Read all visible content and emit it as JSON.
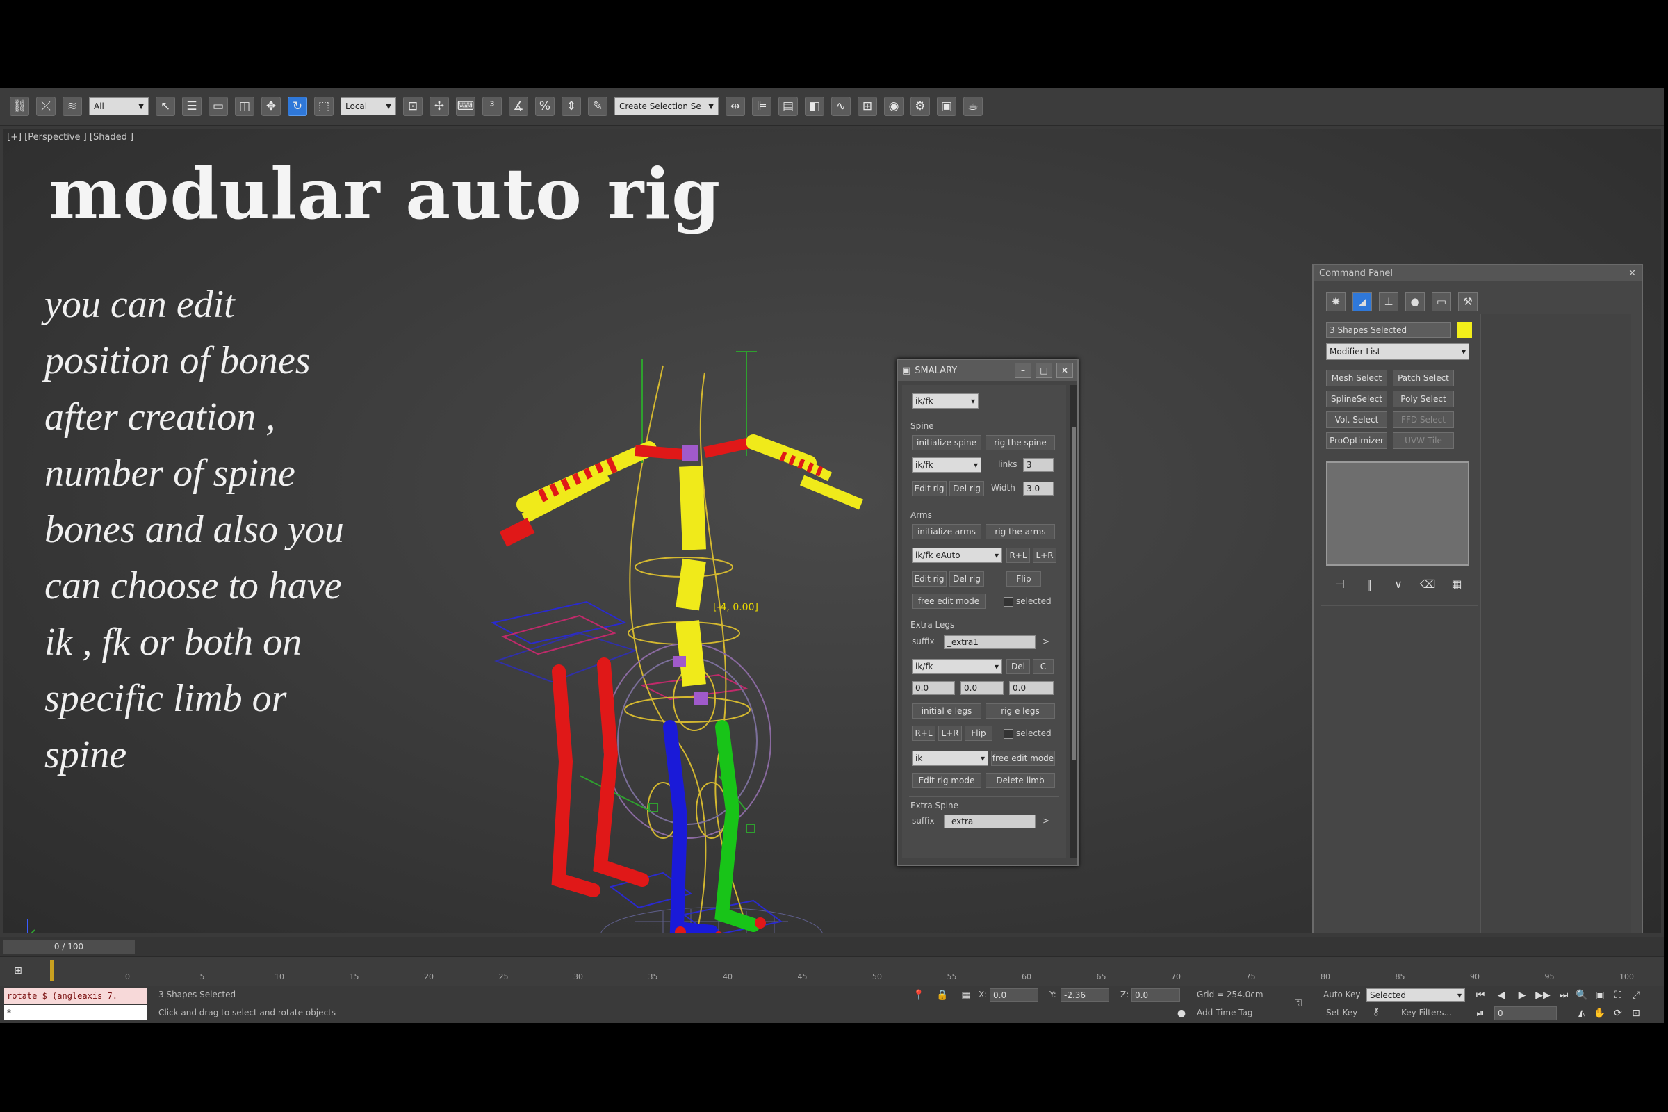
{
  "toolbar": {
    "selection_filter": "All",
    "reference_coord": "Local",
    "named_selection": "Create Selection Se"
  },
  "viewport": {
    "label": "[+] [Perspective ] [Shaded ]",
    "title": "modular auto rig",
    "description_lines": [
      "you can edit",
      "position of bones",
      "after creation  ,",
      "number  of spine",
      "bones  and also you",
      "can choose to have",
      "ik , fk or both on",
      "specific limb or",
      "spine"
    ],
    "bone_readout": "[-4, 0.00]"
  },
  "floater": {
    "title": "SMALARY",
    "top_select": "ik/fk",
    "spine": {
      "group": "Spine",
      "init_btn": "initialize spine",
      "rig_btn": "rig the spine",
      "select": "ik/fk",
      "bones_label": "links",
      "bones_value": "3",
      "edit_btn": "Edit rig",
      "del_btn": "Del rig",
      "width_label": "Width",
      "width_value": "3.0"
    },
    "arms": {
      "group": "Arms",
      "init_btn": "initialize arms",
      "rig_btn": "rig the arms",
      "select": "ik/fk eAuto",
      "rl_btn": "R+L",
      "l_btn": "L+R",
      "edit_btn": "Edit rig",
      "del_btn": "Del rig",
      "flip_btn": "Flip",
      "free_edit_btn": "free edit mode",
      "selected_label": "selected"
    },
    "extra_legs": {
      "group": "Extra Legs",
      "suffix_label": "suffix",
      "suffix_value": "_extra1",
      "select": "ik/fk",
      "del_btn": "Del",
      "c_btn": "C",
      "x_value": "0.0",
      "y_value": "0.0",
      "z_value": "0.0",
      "init_btn": "initial e legs",
      "rig_btn": "rig e legs",
      "rl_btn": "R+L",
      "l_btn": "L+R",
      "flip_btn": "Flip",
      "selected_label": "selected",
      "select2": "ik",
      "free_edit_btn": "free edit mode",
      "edit_btn": "Edit rig mode",
      "delete_btn": "Delete limb"
    },
    "extra_spine": {
      "group": "Extra Spine",
      "suffix_label": "suffix",
      "suffix_value": "_extra"
    }
  },
  "command_panel": {
    "title": "Command Panel",
    "object_name": "3 Shapes Selected",
    "modifier_list": "Modifier List",
    "buttons": [
      "Mesh Select",
      "Patch Select",
      "SplineSelect",
      "Poly Select",
      "Vol. Select",
      "FFD Select",
      "ProOptimizer",
      "UVW Tile"
    ]
  },
  "timeline": {
    "frame_label": "0 / 100",
    "ticks": [
      "0",
      "5",
      "10",
      "15",
      "20",
      "25",
      "30",
      "35",
      "40",
      "45",
      "50",
      "55",
      "60",
      "65",
      "70",
      "75",
      "80",
      "85",
      "90",
      "95",
      "100"
    ]
  },
  "status": {
    "maxscript": "rotate $ (angleaxis 7.",
    "maxscript2": "*",
    "selection": "3 Shapes Selected",
    "prompt": "Click and drag to select and rotate objects",
    "x_label": "X:",
    "x_value": "0.0",
    "y_label": "Y:",
    "y_value": "-2.36",
    "z_label": "Z:",
    "z_value": "0.0",
    "grid": "Grid = 254.0cm",
    "add_time_tag": "Add Time Tag",
    "auto_key": "Auto Key",
    "set_key": "Set Key",
    "key_mode": "Selected",
    "key_filters": "Key Filters...",
    "frame": "0"
  },
  "colors": {
    "viewport_bg": "#3a3a3a",
    "rig_yellow": "#f2ee1a",
    "rig_red": "#e01818",
    "rig_green": "#18c418",
    "rig_blue": "#1a1ad8",
    "accent_blue": "#2f78d9"
  }
}
